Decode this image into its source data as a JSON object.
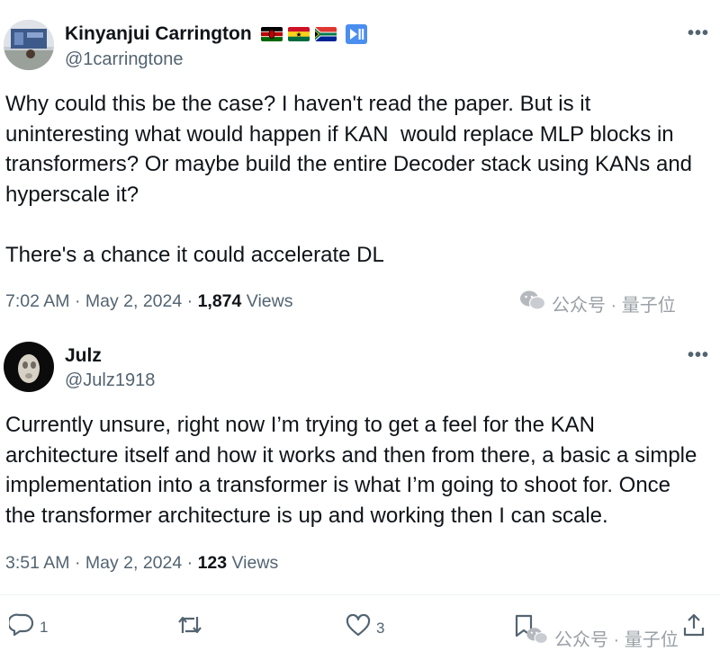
{
  "tweet1": {
    "display_name": "Kinyanjui Carrington",
    "handle": "@1carringtone",
    "flags": [
      "kenya-flag",
      "ghana-flag",
      "south-africa-flag"
    ],
    "badge_icon": "play-pause-icon",
    "text": "Why could this be the case? I haven't read the paper. But is it\nuninteresting what would happen if KAN  would replace MLP blocks in\ntransformers? Or maybe build the entire Decoder stack using KANs and\nhyperscale it?\n\nThere's a chance it could accelerate DL",
    "time": "7:02 AM",
    "date": "May 2, 2024",
    "views_count": "1,874",
    "views_label": "Views"
  },
  "tweet2": {
    "display_name": "Julz",
    "handle": "@Julz1918",
    "text": "Currently unsure, right now I’m trying to get a feel for the KAN\narchitecture itself and how it works and then from there, a basic a simple\nimplementation into a transformer is what I’m going to shoot for. Once\nthe transformer architecture is up and working then I can scale.",
    "time": "3:51 AM",
    "date": "May 2, 2024",
    "views_count": "123",
    "views_label": "Views"
  },
  "separator": "·",
  "more_label": "•••",
  "actions": {
    "reply_count": "1",
    "retweet_count": "",
    "like_count": "3"
  },
  "watermark": {
    "text": "公众号 · 量子位"
  }
}
